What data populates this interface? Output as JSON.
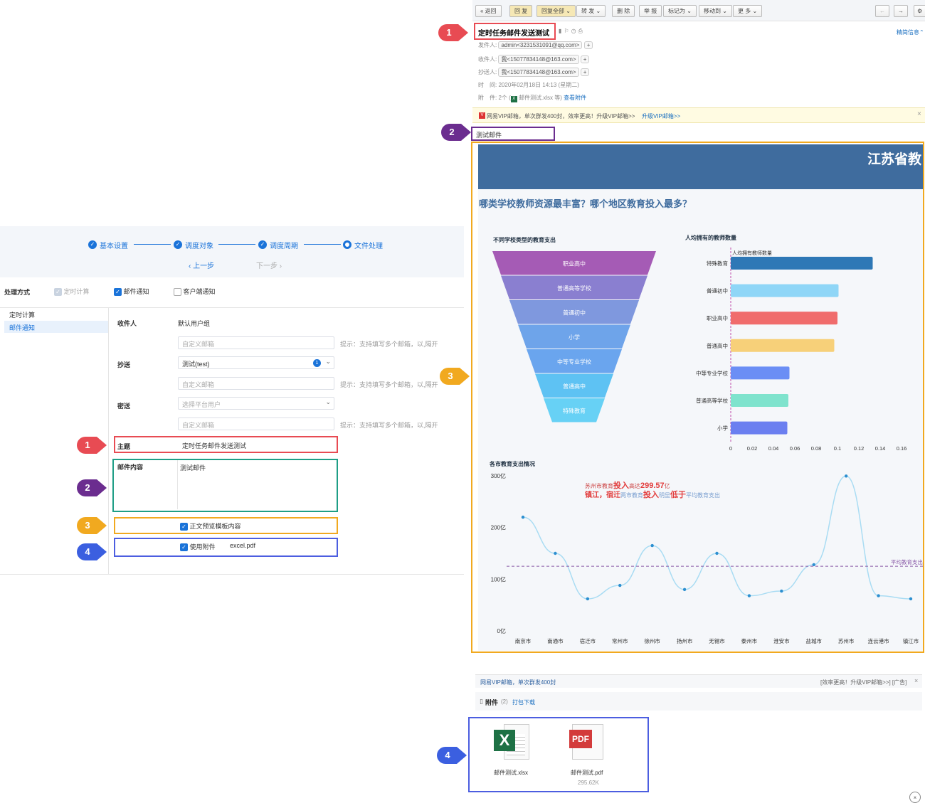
{
  "left": {
    "steps": [
      "基本设置",
      "调度对象",
      "调度周期",
      "文件处理"
    ],
    "prev": "上一步",
    "next": "下一步",
    "mode_label": "处理方式",
    "mode_options": [
      {
        "label": "定时计算",
        "state": "disabled-checked"
      },
      {
        "label": "邮件通知",
        "state": "checked"
      },
      {
        "label": "客户端通知",
        "state": "unchecked"
      }
    ],
    "side_menu": [
      "定时计算",
      "邮件通知"
    ],
    "receiver_label": "收件人",
    "receiver_value": "默认用户组",
    "custom_mail_placeholder": "自定义邮箱",
    "hint": "提示：支持填写多个邮箱，以,隔开",
    "cc_label": "抄送",
    "cc_value": "测试(test)",
    "cc_count": "1",
    "bcc_label": "密送",
    "bcc_placeholder": "选择平台用户",
    "subject_label": "主题",
    "subject_value": "定时任务邮件发送测试",
    "content_label": "邮件内容",
    "content_value": "测试邮件",
    "preview_label": "正文预览模板内容",
    "attach_label": "使用附件",
    "attach_value": "excel.pdf"
  },
  "annotations": [
    "1",
    "2",
    "3",
    "4"
  ],
  "email": {
    "toolbar": [
      "返回",
      "回 复",
      "回复全部",
      "转 发",
      "删 除",
      "举 报",
      "标记为",
      "移动到",
      "更 多"
    ],
    "subject": "定时任务邮件发送测试",
    "brief": "精简信息",
    "from_label": "发件人:",
    "from": "admin<3231531091@qq.com>",
    "to_label": "收件人:",
    "to": "我<15077834148@163.com>",
    "cc_label": "抄送人:",
    "cc": "我<15077834148@163.com>",
    "time_label": "时　间:",
    "time": "2020年02月18日 14:13 (星期二)",
    "attach_label": "附　件:",
    "attach_summary": "2个 (",
    "attach_file": "邮件测试.xlsx 等)",
    "attach_view": "查看附件",
    "vip_banner": "网易VIP邮箱，单次群发400封，效率更高！升级VIP邮箱>>",
    "vip_link": "升级VIP邮箱>>",
    "body_text": "测试邮件",
    "bottom_banner_left": "网易VIP邮箱，单次群发400封",
    "bottom_banner_right": "[效率更高！升级VIP邮箱>>] [广告]",
    "attachments_title": "附件",
    "attachments_count": "(2)",
    "attachments_pack": "打包下载",
    "files": [
      {
        "name": "邮件测试.xlsx",
        "size": ""
      },
      {
        "name": "邮件测试.pdf",
        "size": "295.62K"
      }
    ]
  },
  "report": {
    "banner_title": "江苏省教",
    "headline": "哪类学校教师资源最丰富？哪个地区教育投入最多？",
    "funnel_title": "不同学校类型的教育支出",
    "bar_title": "人均拥有的教师数量",
    "line_title": "各市教育支出情况",
    "annot_line1_a": "苏州市教育",
    "annot_line1_b": "投入",
    "annot_line1_c": "高达",
    "annot_line1_d": "299.57",
    "annot_line1_e": "亿",
    "annot_line2_a": "镇江，宿迁",
    "annot_line2_b": "两市教育",
    "annot_line2_c": "投入",
    "annot_line2_d": "明显",
    "annot_line2_e": "低于",
    "annot_line2_f": "平均教育支出",
    "avg_label": "平均教育支出"
  },
  "chart_data": [
    {
      "type": "funnel",
      "title": "不同学校类型的教育支出",
      "categories": [
        "职业高中",
        "普通高等学校",
        "普通初中",
        "小学",
        "中等专业学校",
        "普通高中",
        "特殊教育"
      ],
      "colors": [
        "#a55bb5",
        "#8a7fd0",
        "#7f98de",
        "#6ea4ea",
        "#6aa5ee",
        "#5ec2f3",
        "#67d1f5"
      ]
    },
    {
      "type": "bar",
      "orientation": "horizontal",
      "title": "人均拥有的教师数量",
      "legend": "人均拥有教师数量",
      "categories": [
        "特殊教育",
        "普通初中",
        "职业高中",
        "普通高中",
        "中等专业学校",
        "普通高等学校",
        "小学"
      ],
      "values": [
        0.133,
        0.101,
        0.1,
        0.097,
        0.055,
        0.054,
        0.053
      ],
      "colors": [
        "#2e78b6",
        "#8fd6f7",
        "#f06c6c",
        "#f7d079",
        "#6b8ef5",
        "#7fe3cd",
        "#6b7ff0"
      ],
      "xlim": [
        0,
        0.16
      ],
      "xticks": [
        "0",
        "0.02",
        "0.04",
        "0.06",
        "0.08",
        "0.1",
        "0.12",
        "0.14",
        "0.16"
      ]
    },
    {
      "type": "line",
      "title": "各市教育支出情况",
      "categories": [
        "南京市",
        "南通市",
        "宿迁市",
        "常州市",
        "徐州市",
        "扬州市",
        "无锡市",
        "泰州市",
        "淮安市",
        "盐城市",
        "苏州市",
        "连云港市",
        "镇江市"
      ],
      "values": [
        220,
        150,
        62,
        88,
        165,
        80,
        150,
        68,
        77,
        128,
        299.57,
        68,
        62
      ],
      "average": 125,
      "yticks": [
        "0亿",
        "100亿",
        "200亿",
        "300亿"
      ],
      "ylim": [
        0,
        300
      ]
    }
  ]
}
